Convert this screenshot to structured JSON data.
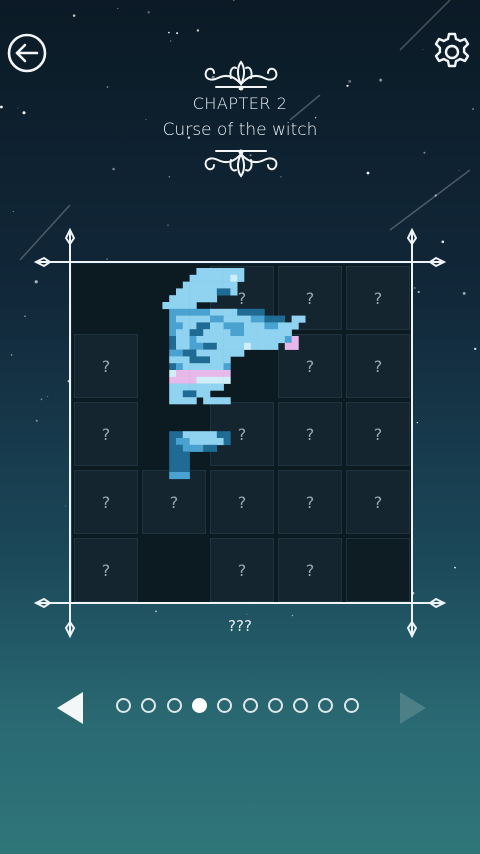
{
  "header": {
    "chapter": "CHAPTER 2",
    "title": "Curse of the witch",
    "back_icon": "arrow-left-circle-icon",
    "settings_icon": "gear-icon"
  },
  "puzzle": {
    "name": "???",
    "rows": 5,
    "cols": 5,
    "cells": [
      [
        "open",
        "open",
        "?",
        "?",
        "?"
      ],
      [
        "?",
        "open",
        "open",
        "?",
        "?"
      ],
      [
        "?",
        "open",
        "?",
        "?",
        "?"
      ],
      [
        "?",
        "?",
        "?",
        "?",
        "?"
      ],
      [
        "?",
        "open",
        "?",
        "?",
        "empty"
      ]
    ]
  },
  "pager": {
    "pages": 10,
    "active_page": 4,
    "prev_icon": "triangle-left-icon",
    "next_icon": "triangle-right-icon",
    "next_disabled": true
  },
  "colors": {
    "light_blue": "#8fd3f0",
    "mid_blue": "#4aa2d0",
    "dark_blue": "#1f6b93",
    "pale": "#cfeef8",
    "pink": "#e7b8ea"
  }
}
